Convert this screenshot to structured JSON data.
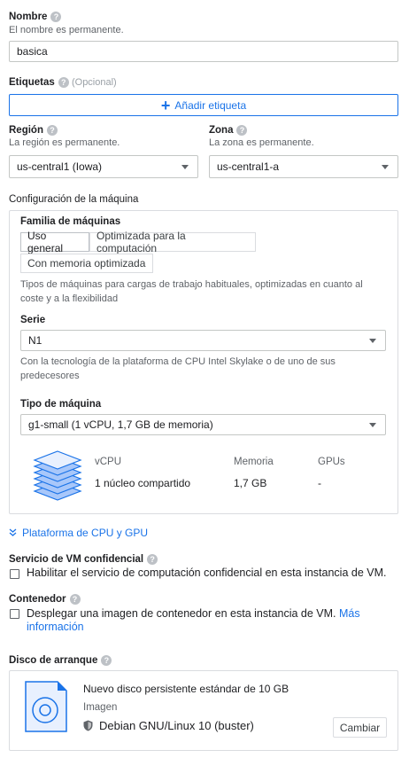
{
  "name": {
    "label": "Nombre",
    "hint": "El nombre es permanente.",
    "value": "basica"
  },
  "labels": {
    "label": "Etiquetas",
    "optional": "(Opcional)",
    "add_button": "Añadir etiqueta"
  },
  "region": {
    "label": "Región",
    "hint": "La región es permanente.",
    "value": "us-central1 (Iowa)"
  },
  "zone": {
    "label": "Zona",
    "hint": "La zona es permanente.",
    "value": "us-central1-a"
  },
  "machine_config": {
    "heading": "Configuración de la máquina",
    "family_label": "Familia de máquinas",
    "tabs": [
      "Uso general",
      "Optimizada para la computación",
      "Con memoria optimizada"
    ],
    "active_tab": "Uso general",
    "family_description": "Tipos de máquinas para cargas de trabajo habituales, optimizadas en cuanto al coste y a la flexibilidad",
    "series_label": "Serie",
    "series_value": "N1",
    "series_description": "Con la tecnología de la plataforma de CPU Intel Skylake o de uno de sus predecesores",
    "type_label": "Tipo de máquina",
    "type_value": "g1-small (1 vCPU, 1,7 GB de memoria)",
    "specs": {
      "vcpu_header": "vCPU",
      "memory_header": "Memoria",
      "gpu_header": "GPUs",
      "vcpu_value": "1 núcleo compartido",
      "memory_value": "1,7 GB",
      "gpu_value": "-"
    }
  },
  "cpu_platform_link": "Plataforma de CPU y GPU",
  "confidential": {
    "label": "Servicio de VM confidencial",
    "checkbox_label": "Habilitar el servicio de computación confidencial en esta instancia de VM."
  },
  "container": {
    "label": "Contenedor",
    "checkbox_label": "Desplegar una imagen de contenedor en esta instancia de VM.",
    "more_link_1": "Más",
    "more_link_2": "información"
  },
  "boot_disk": {
    "label": "Disco de arranque",
    "title": "Nuevo disco persistente estándar de 10 GB",
    "image_label": "Imagen",
    "image_value": "Debian GNU/Linux 10 (buster)",
    "change_button": "Cambiar"
  },
  "colors": {
    "accent": "#1a73e8",
    "text": "#202124",
    "muted": "#5f6368",
    "border": "#dadce0"
  }
}
